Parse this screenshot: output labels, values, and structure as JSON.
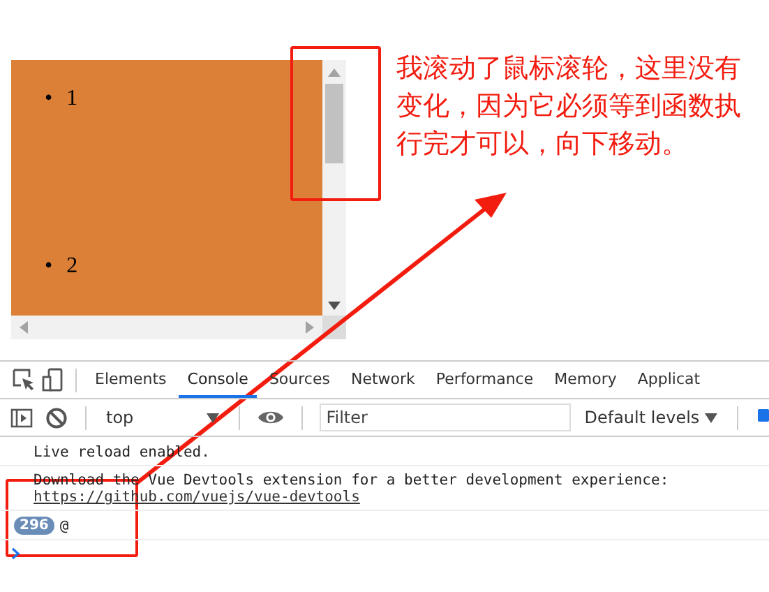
{
  "page": {
    "list_items": [
      {
        "marker": "•",
        "text": "1"
      },
      {
        "marker": "•",
        "text": "2"
      }
    ]
  },
  "annotation": {
    "text": "我滚动了鼠标滚轮，这里没有变化，因为它必须等到函数执行完才可以，向下移动。"
  },
  "devtools": {
    "tabs": [
      {
        "label": "Elements",
        "selected": false
      },
      {
        "label": "Console",
        "selected": true
      },
      {
        "label": "Sources",
        "selected": false
      },
      {
        "label": "Network",
        "selected": false
      },
      {
        "label": "Performance",
        "selected": false
      },
      {
        "label": "Memory",
        "selected": false
      },
      {
        "label": "Applicat",
        "selected": false
      }
    ],
    "context": "top",
    "filter": {
      "placeholder": "Filter"
    },
    "levels": "Default levels",
    "messages": [
      {
        "kind": "text",
        "text": "Live reload enabled."
      },
      {
        "kind": "link",
        "text": "Download the Vue Devtools extension for a better development experience:",
        "link": "https://github.com/vuejs/vue-devtools"
      },
      {
        "kind": "count",
        "count": "296",
        "text": "@"
      }
    ]
  }
}
